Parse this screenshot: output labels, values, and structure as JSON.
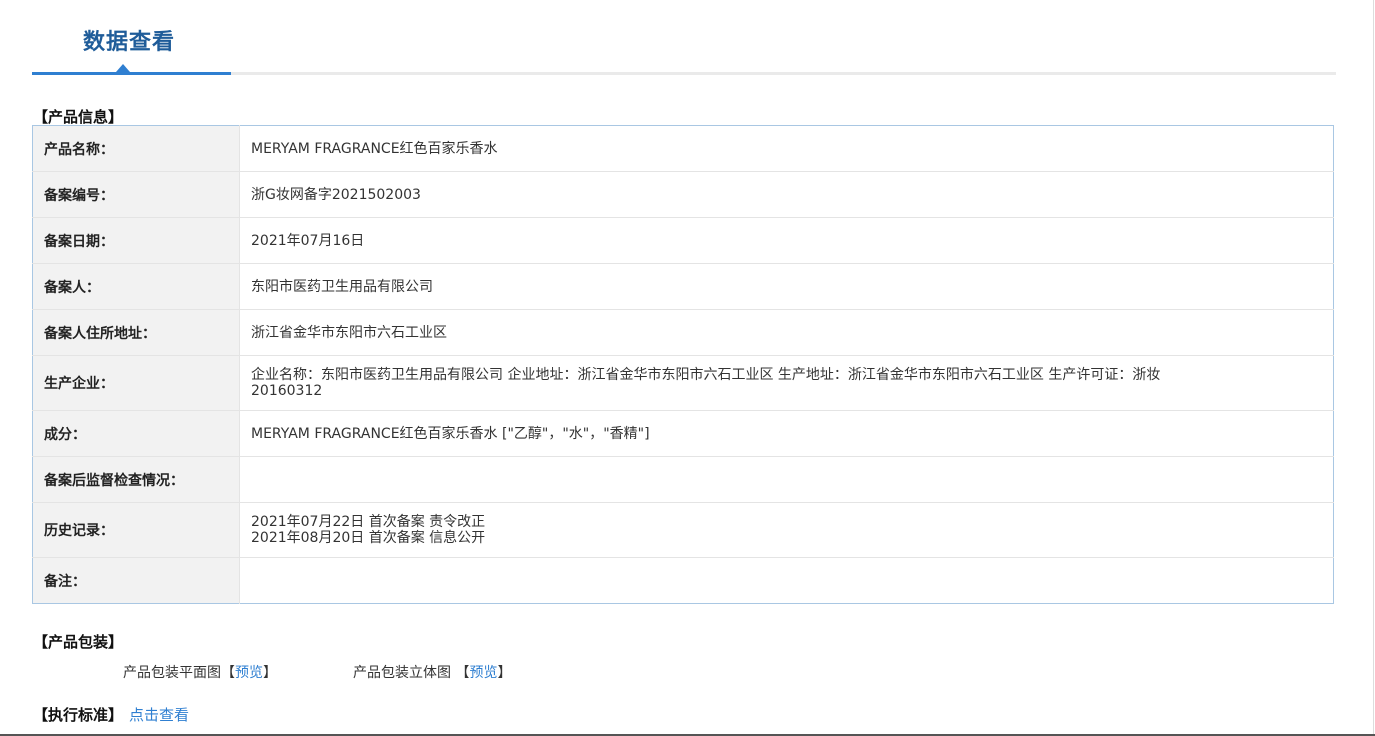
{
  "tab": {
    "title": "数据查看"
  },
  "product_info": {
    "heading": "【产品信息】",
    "rows": [
      {
        "label": "产品名称：",
        "lines": [
          "MERYAM FRAGRANCE红色百家乐香水"
        ]
      },
      {
        "label": "备案编号：",
        "lines": [
          "浙G妆网备字2021502003"
        ]
      },
      {
        "label": "备案日期：",
        "lines": [
          "2021年07月16日"
        ]
      },
      {
        "label": "备案人：",
        "lines": [
          "东阳市医药卫生用品有限公司"
        ]
      },
      {
        "label": "备案人住所地址：",
        "lines": [
          "浙江省金华市东阳市六石工业区"
        ]
      },
      {
        "label": "生产企业：",
        "lines": [
          "企业名称：东阳市医药卫生用品有限公司 企业地址：浙江省金华市东阳市六石工业区 生产地址：浙江省金华市东阳市六石工业区 生产许可证：浙妆",
          "20160312"
        ]
      },
      {
        "label": "成分：",
        "lines": [
          "MERYAM FRAGRANCE红色百家乐香水 [\"乙醇\"，\"水\"，\"香精\"]"
        ]
      },
      {
        "label": "备案后监督检查情况：",
        "lines": [
          ""
        ]
      },
      {
        "label": "历史记录：",
        "lines": [
          "2021年07月22日 首次备案 责令改正",
          "2021年08月20日 首次备案 信息公开"
        ]
      },
      {
        "label": "备注：",
        "lines": [
          ""
        ]
      }
    ]
  },
  "packaging": {
    "heading": "【产品包装】",
    "flat": {
      "label": "产品包装平面图",
      "bracket_open": "【",
      "link": "预览",
      "bracket_close": "】"
    },
    "solid": {
      "label": "产品包装立体图",
      "bracket_open": "【",
      "link": "预览",
      "bracket_close": "】"
    }
  },
  "standard": {
    "heading": "【执行标准】",
    "link": "点击查看"
  },
  "colors": {
    "accent": "#2f7fd1",
    "title": "#1f5c99",
    "label_bg": "#f2f2f2",
    "table_border": "#a9c7e3"
  }
}
